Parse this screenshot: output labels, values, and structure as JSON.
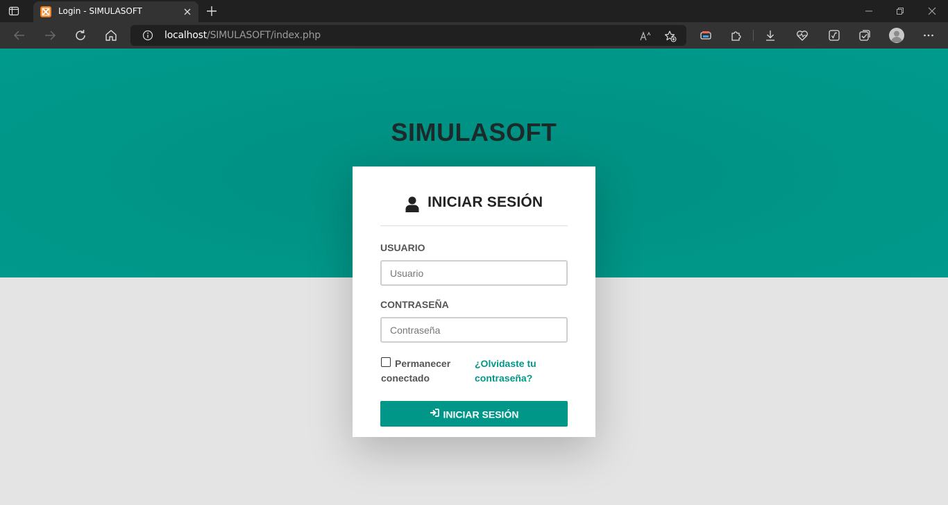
{
  "browser": {
    "tab_title": "Login - SIMULASOFT",
    "url_host": "localhost",
    "url_path": "/SIMULASOFT/index.php",
    "icons": [
      "tab-actions-icon",
      "xampp-favicon-icon",
      "close-icon",
      "plus-icon",
      "back-icon",
      "forward-icon",
      "refresh-icon",
      "home-icon",
      "info-icon",
      "read-aloud-icon",
      "add-favorite-icon",
      "browser-essentials-icon",
      "extensions-icon",
      "download-icon",
      "health-icon",
      "math-solver-icon",
      "collections-icon",
      "profile-icon",
      "more-icon"
    ]
  },
  "page": {
    "brand": "SIMULASOFT",
    "accent_color": "#009688",
    "login": {
      "heading": "INICIAR SESIÓN",
      "user_label": "USUARIO",
      "user_placeholder": "Usuario",
      "password_label": "CONTRASEÑA",
      "password_placeholder": "Contraseña",
      "remember_label": "Permanecer conectado",
      "forgot_label": "¿Olvidaste tu contraseña?",
      "submit_label": "INICIAR SESIÓN"
    }
  }
}
